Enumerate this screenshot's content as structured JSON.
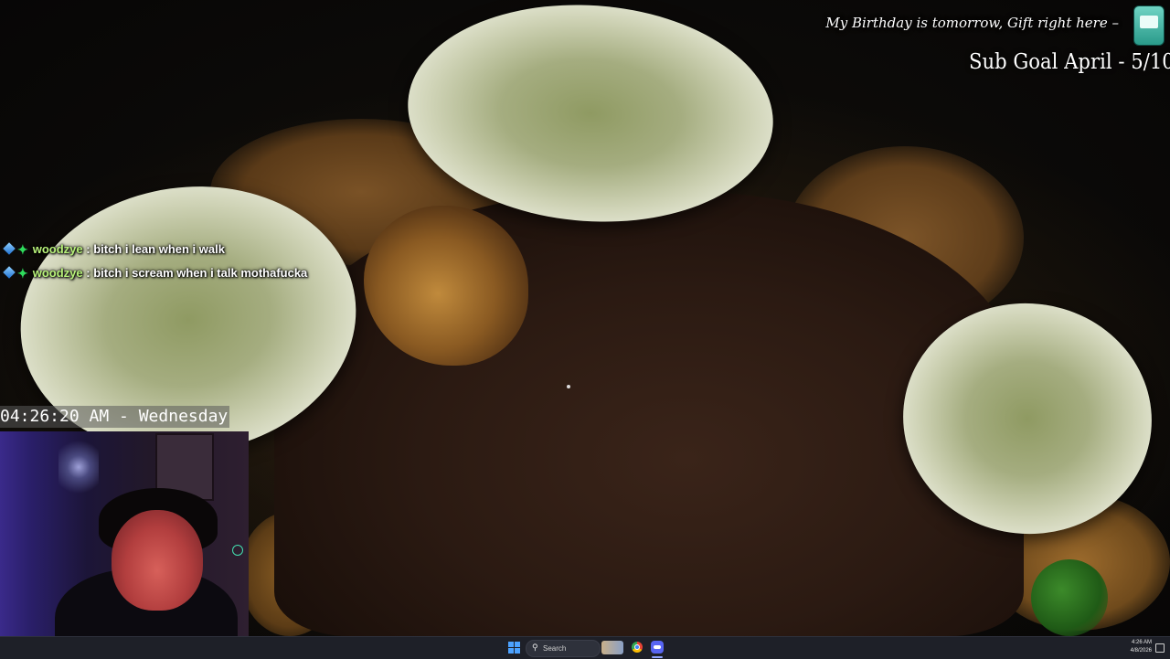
{
  "overlay": {
    "birthday_text": "My Birthday is tomorrow, Gift right here –",
    "sub_goal_text": "Sub Goal April - 5/10"
  },
  "chat": {
    "messages": [
      {
        "user": "woodzye",
        "text": ": bitch i lean when i walk"
      },
      {
        "user": "woodzye",
        "text": ": bitch i scream when i talk mothafucka"
      }
    ]
  },
  "clock": {
    "text": "04:26:20 AM - Wednesday"
  },
  "taskbar": {
    "search_label": "Search",
    "search_icon": "search-icon",
    "tray_time": "4:26 AM",
    "tray_date": "4/8/2026"
  },
  "colors": {
    "chat_username": "#b8f27a",
    "taskbar_bg": "#1e2028",
    "start_blue": "#4ca2ff",
    "discord": "#5865f2"
  }
}
